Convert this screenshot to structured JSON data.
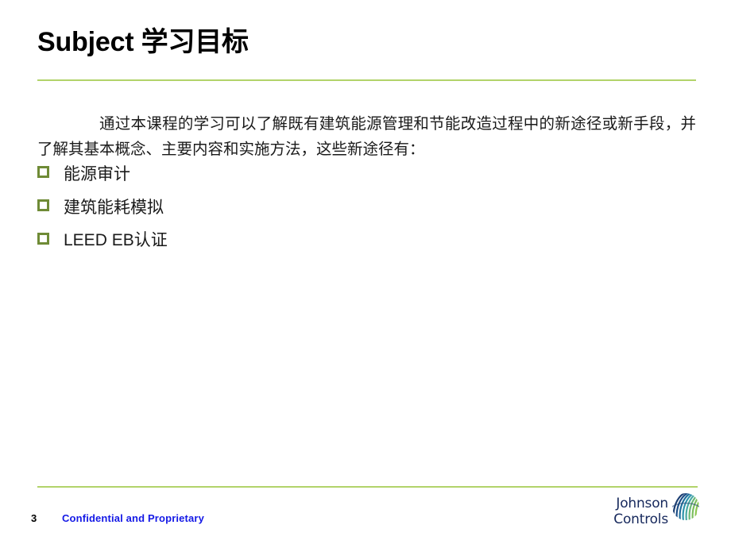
{
  "slide": {
    "title": "Subject 学习目标",
    "page_number": "3",
    "confidentiality_note": "Confidential and Proprietary",
    "body_paragraph": "通过本课程的学习可以了解既有建筑能源管理和节能改造过程中的新途径或新手段，并了解其基本概念、主要内容和实施方法，这些新途径有：",
    "bullets": [
      {
        "label": "能源审计",
        "marker": "square-outline-bullet-icon"
      },
      {
        "label": "建筑能耗模拟",
        "marker": "square-outline-bullet-icon"
      },
      {
        "label": "LEED EB认证",
        "marker": "square-outline-bullet-icon"
      }
    ],
    "logo": {
      "line1": "Johnson",
      "line2": "Controls",
      "mark": "johnson-controls-sphere-icon"
    },
    "colors": {
      "background": "#ffffff",
      "title_text": "#000000",
      "body_text": "#1a1a1a",
      "rule_green": "#b2d36a",
      "bullet_green": "#6f8b36",
      "footer_blue": "#1419e6",
      "logo_navy": "#16285c"
    }
  }
}
